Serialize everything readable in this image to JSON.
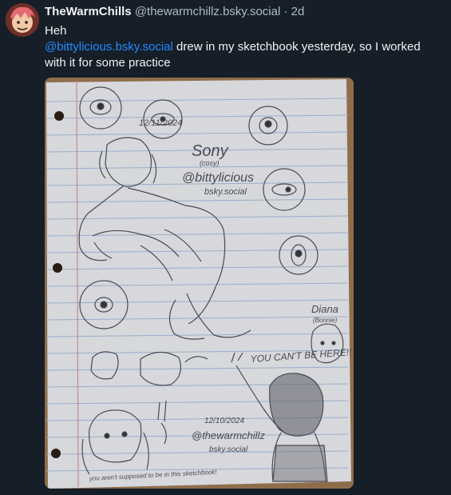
{
  "post": {
    "author": {
      "display_name": "TheWarmChills",
      "handle": "@thewarmchillz.bsky.social",
      "separator": "·",
      "time_ago": "2d",
      "avatar": "avatar-image"
    },
    "text": {
      "line1": "Heh",
      "mention": "@bittylicious.bsky.social",
      "rest": " drew in my sketchbook yesterday, so I worked with it for some practice"
    },
    "image": {
      "description": "photo-of-sketchbook-page",
      "handwriting": {
        "date_top": "12/11/2024",
        "name1": "Sony",
        "name1_sub": "(cosy)",
        "handle1": "@bittylicious",
        "handle1_sub": "bsky.social",
        "name2": "Diana",
        "name2_sub": "(Bonnie)",
        "speech": "YOU CAN'T BE HERE!!",
        "date_bottom": "12/10/2024",
        "handle2": "@thewarmchillz",
        "handle2_sub": "bsky.social",
        "bottom_note": "you aren't supposed to be in this sketchbook!"
      }
    }
  }
}
